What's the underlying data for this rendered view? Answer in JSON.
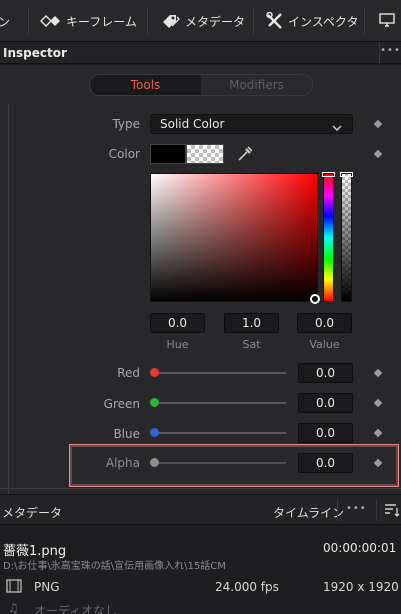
{
  "toolbar": {
    "partial_label": "ン",
    "keyframe_label": "キーフレーム",
    "metadata_label": "メタデータ",
    "inspector_label": "インスペクタ"
  },
  "inspector": {
    "title": "Inspector",
    "more": "•••",
    "tabs": [
      {
        "label": "Tools",
        "active": true
      },
      {
        "label": "Modifiers",
        "active": false
      }
    ]
  },
  "tools": {
    "type": {
      "label": "Type",
      "value": "Solid Color"
    },
    "color": {
      "label": "Color"
    },
    "hsv": {
      "hue": {
        "label": "Hue",
        "value": "0.0"
      },
      "sat": {
        "label": "Sat",
        "value": "1.0"
      },
      "value": {
        "label": "Value",
        "value": "0.0"
      }
    },
    "channels": [
      {
        "label": "Red",
        "value": "0.0",
        "color": "#e23a2e"
      },
      {
        "label": "Green",
        "value": "0.0",
        "color": "#2fb43a"
      },
      {
        "label": "Blue",
        "value": "0.0",
        "color": "#2f63d8"
      },
      {
        "label": "Alpha",
        "value": "0.0",
        "color": "#8e8e8e"
      }
    ]
  },
  "metadata": {
    "title": "メタデータ",
    "timeline_label": "タイムライン",
    "more": "•••",
    "file_name": "薔薇1.png",
    "timecode": "00:00:00:01",
    "path": "D:\\お仕事\\氷高宝珠の話\\宣伝用画像入れ\\15話CM",
    "format": "PNG",
    "fps": "24.000 fps",
    "resolution": "1920 x 1920",
    "audio_label": "オーディオなし"
  },
  "colors": {
    "accent": "#e3624f",
    "panel_bg": "#28282b",
    "field_bg": "#1a1a1c",
    "highlight_border": "#e08a8a"
  }
}
